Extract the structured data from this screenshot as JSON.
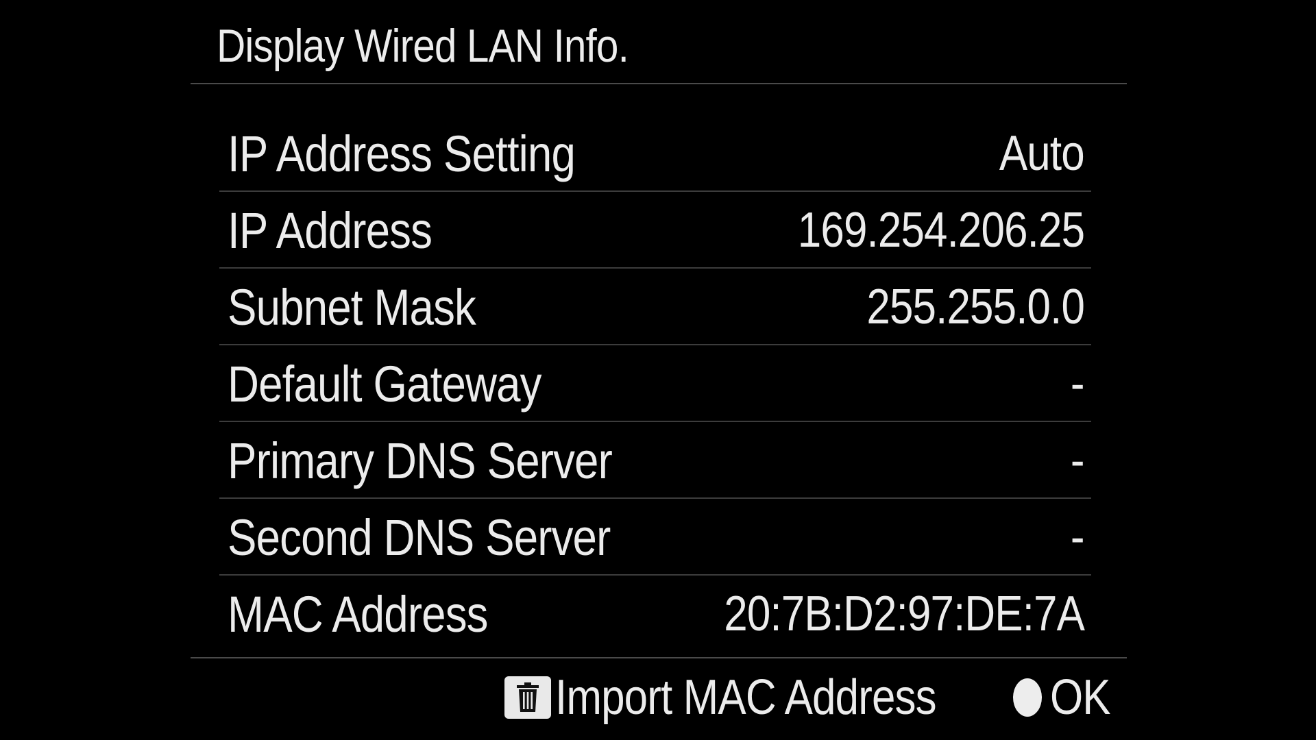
{
  "screen": {
    "title": "Display Wired LAN Info."
  },
  "rows": [
    {
      "label": "IP Address Setting",
      "value": "Auto"
    },
    {
      "label": "IP Address",
      "value": "169.254.206.25"
    },
    {
      "label": "Subnet Mask",
      "value": "255.255.0.0"
    },
    {
      "label": "Default Gateway",
      "value": "-"
    },
    {
      "label": "Primary DNS Server",
      "value": "-"
    },
    {
      "label": "Second DNS Server",
      "value": "-"
    },
    {
      "label": "MAC Address",
      "value": "20:7B:D2:97:DE:7A"
    }
  ],
  "footer": {
    "import_icon": "trash-icon",
    "import_label": "Import MAC Address",
    "ok_icon": "center-button-dot-icon",
    "ok_label": "OK"
  },
  "colors": {
    "background": "#000000",
    "text": "#ececec",
    "rule": "#4a4a4a"
  }
}
